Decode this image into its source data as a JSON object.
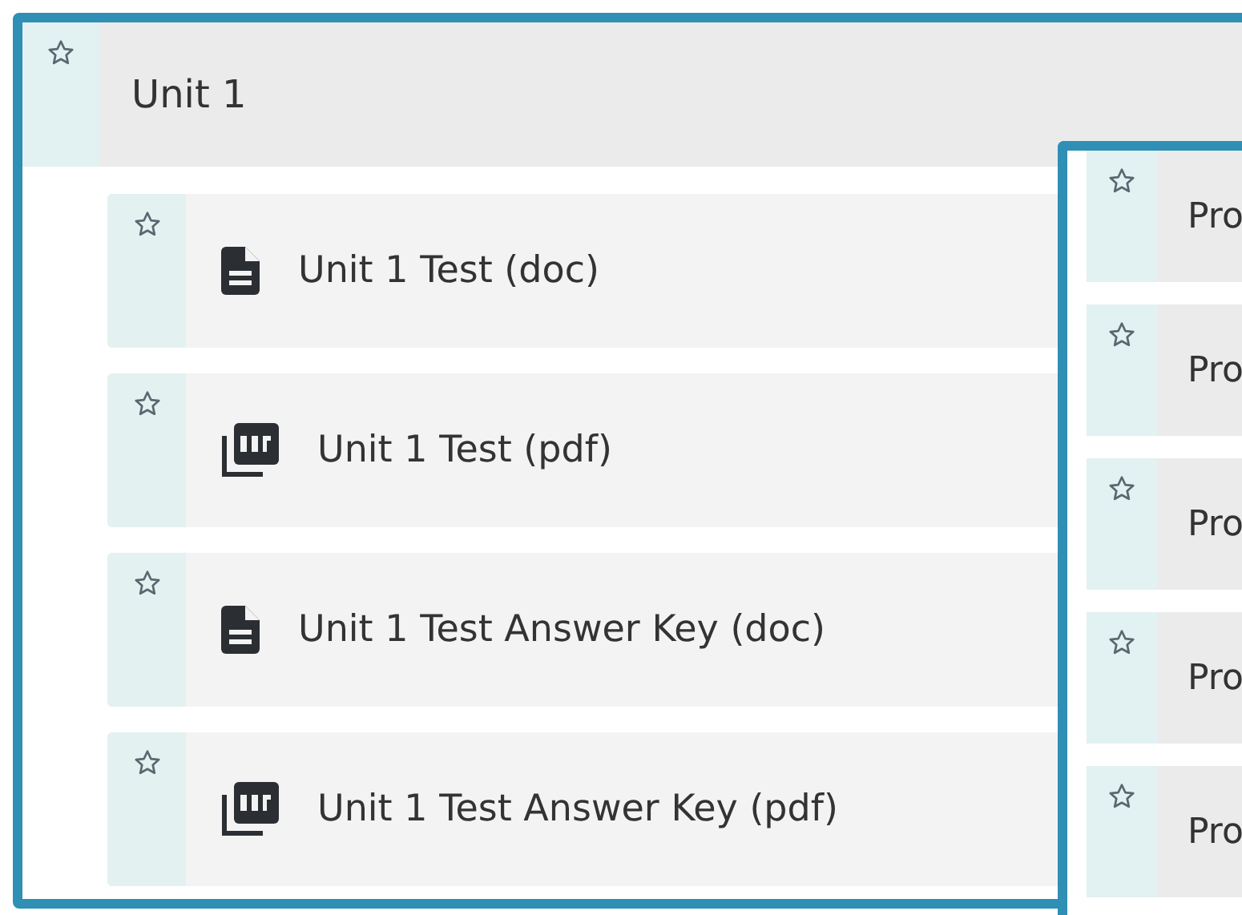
{
  "unit": {
    "title": "Unit 1",
    "starred": false,
    "items": [
      {
        "kind": "doc",
        "title": "Unit 1 Test (doc)",
        "starred": false
      },
      {
        "kind": "pdf",
        "title": "Unit 1 Test (pdf)",
        "starred": false
      },
      {
        "kind": "doc",
        "title": "Unit 1 Test Answer Key (doc)",
        "starred": false
      },
      {
        "kind": "pdf",
        "title": "Unit 1 Test Answer Key (pdf)",
        "starred": false
      }
    ]
  },
  "overlay_panel": {
    "items": [
      {
        "title": "Pro",
        "starred": false
      },
      {
        "title": "Pro",
        "starred": false
      },
      {
        "title": "Pro",
        "starred": false
      },
      {
        "title": "Pro",
        "starred": false
      },
      {
        "title": "Pro",
        "starred": false
      }
    ]
  }
}
